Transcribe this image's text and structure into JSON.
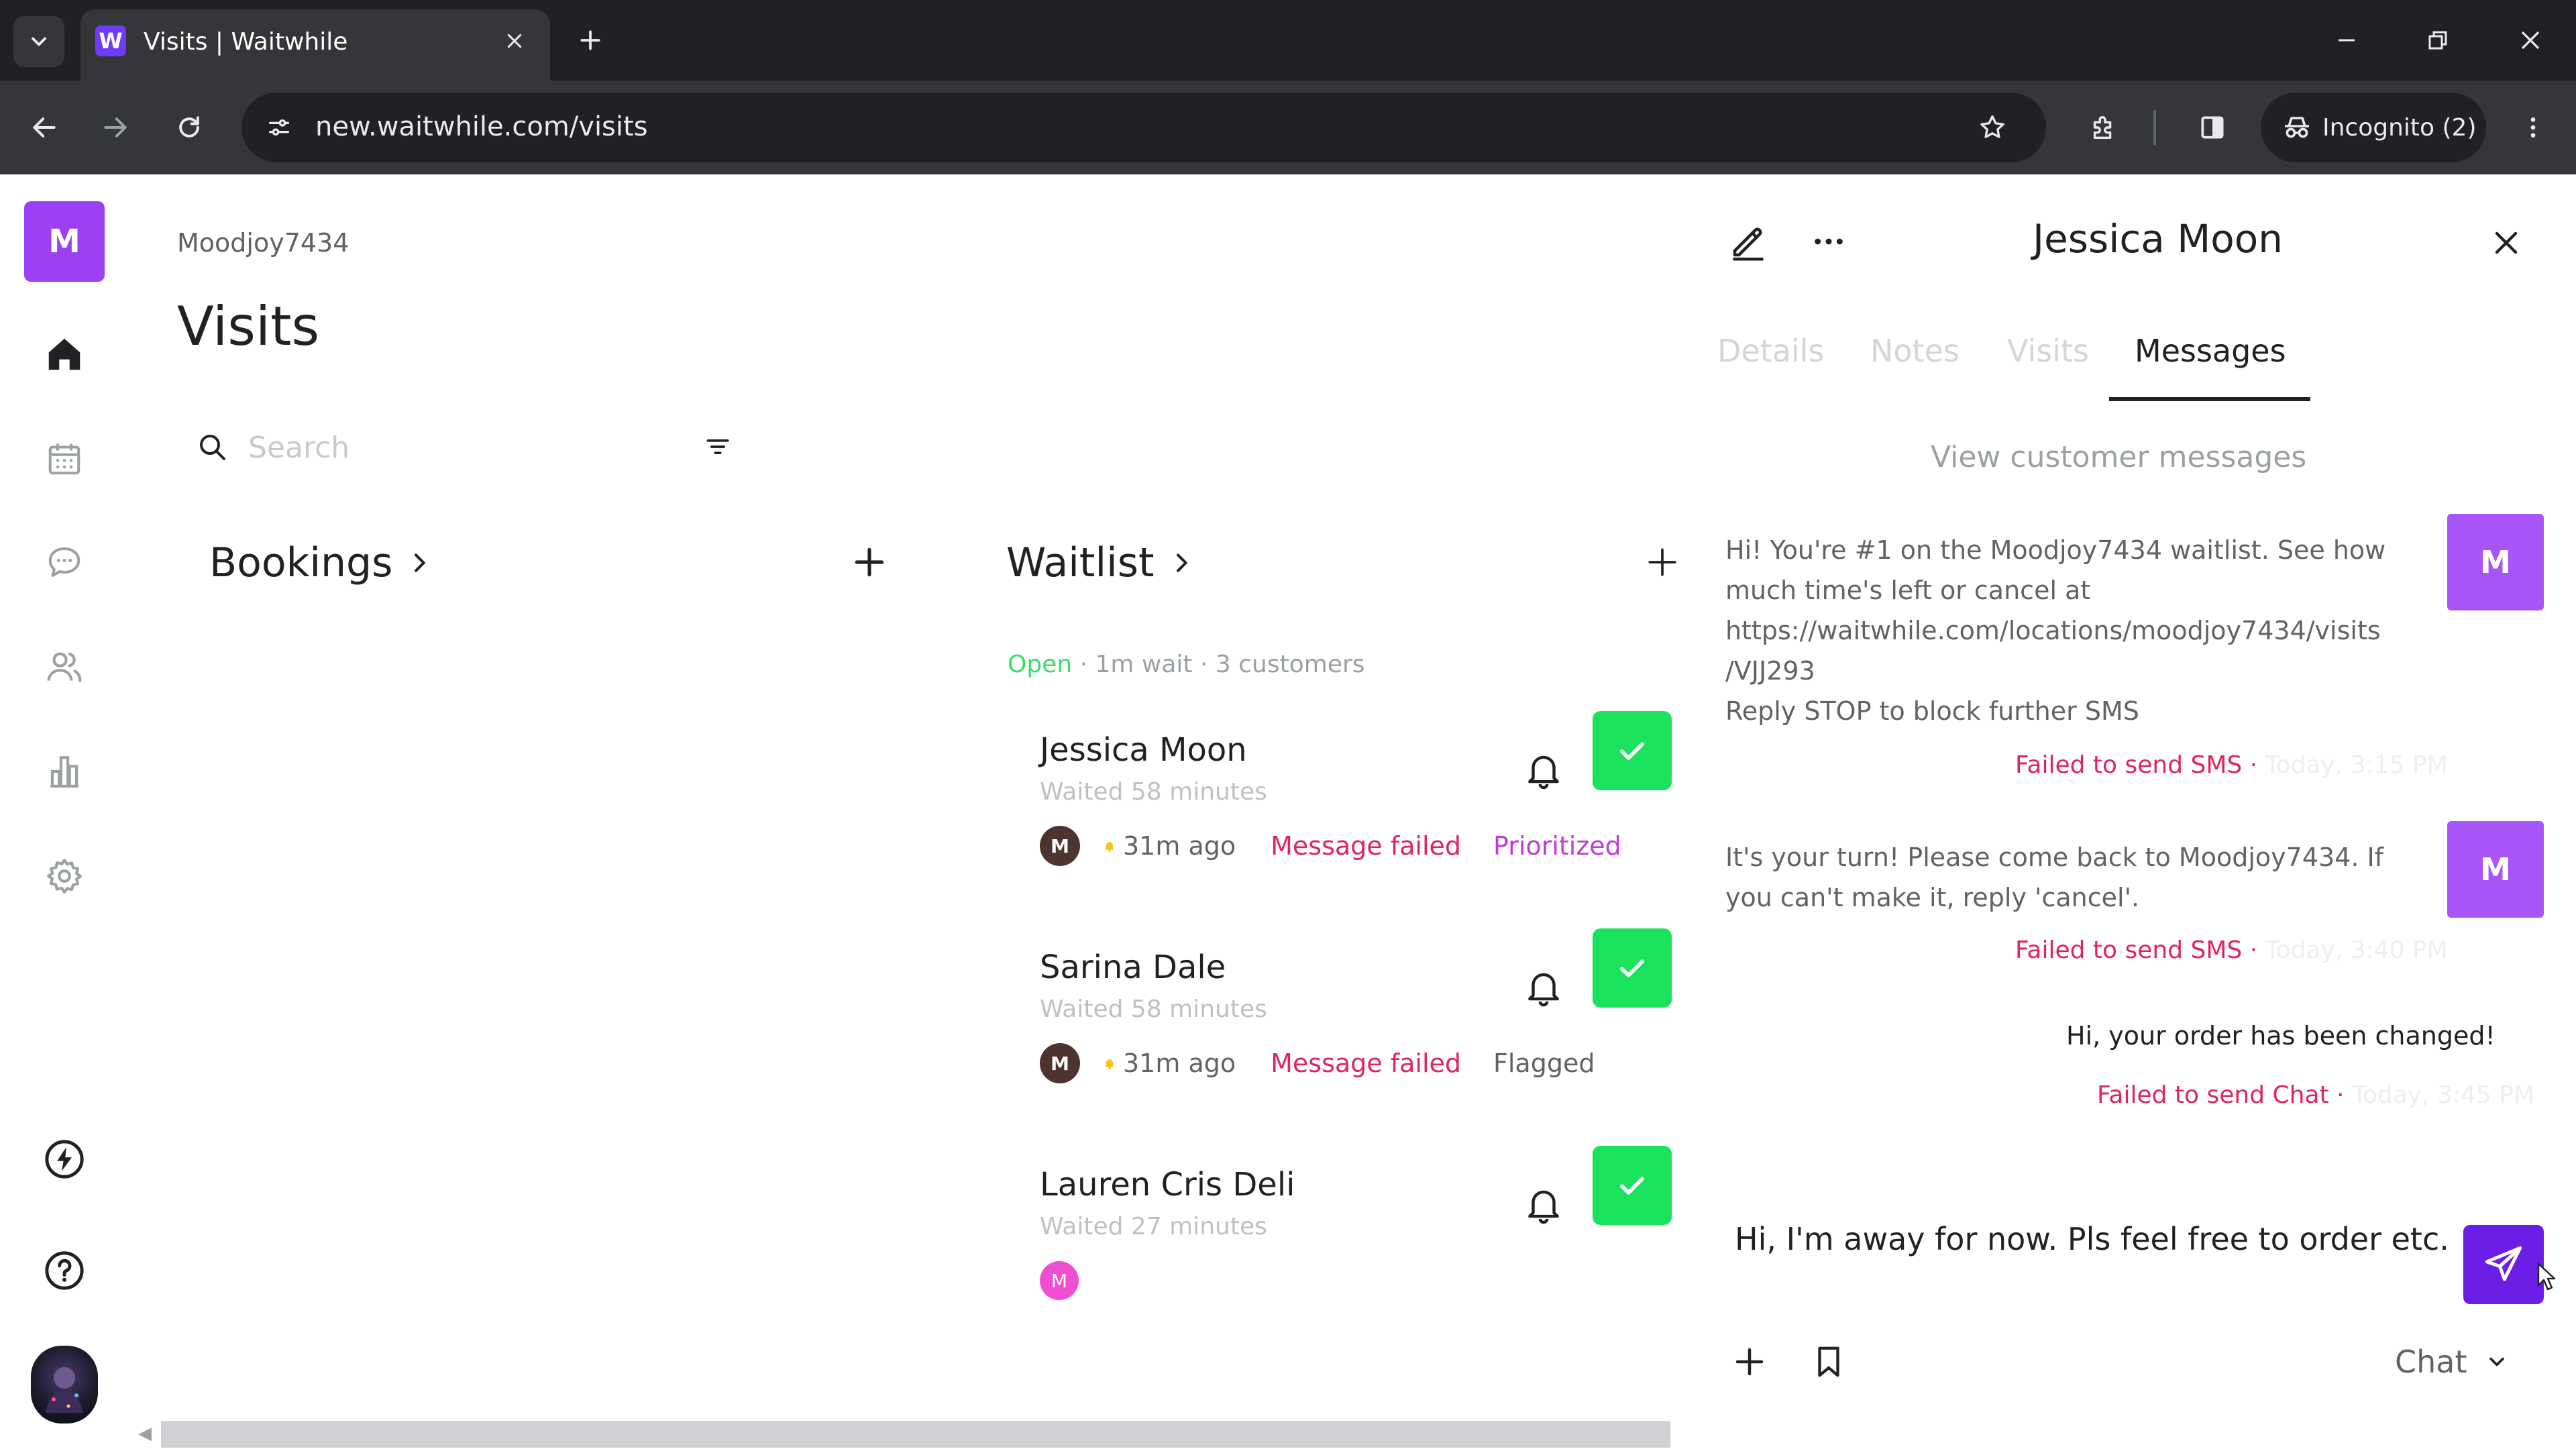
{
  "browser": {
    "tab_title": "Visits | Waitwhile",
    "favicon_letter": "W",
    "url": "new.waitwhile.com/visits",
    "incognito_label": "Incognito (2)"
  },
  "sidebar": {
    "org_initial": "M",
    "nav_icons": [
      "home-icon",
      "calendar-icon",
      "chat-icon",
      "customers-icon",
      "analytics-icon",
      "settings-icon",
      "lightning-icon",
      "help-icon"
    ]
  },
  "main": {
    "org_name": "Moodjoy7434",
    "title": "Visits",
    "search_placeholder": "Search",
    "bookings_label": "Bookings",
    "waitlist_label": "Waitlist",
    "waitlist_status": {
      "open": "Open",
      "wait": "1m wait",
      "customers": "3 customers",
      "separator": " · "
    },
    "waitlist": [
      {
        "name": "Jessica Moon",
        "waited": "Waited 58 minutes",
        "avatar": "M",
        "ago": "31m ago",
        "status": "Message failed",
        "tag": "Prioritized"
      },
      {
        "name": "Sarina Dale",
        "waited": "Waited 58 minutes",
        "avatar": "M",
        "ago": "31m ago",
        "status": "Message failed",
        "tag": "Flagged"
      },
      {
        "name": "Lauren Cris Deli",
        "waited": "Waited 27 minutes",
        "avatar": "M"
      }
    ]
  },
  "panel": {
    "customer_name": "Jessica Moon",
    "tabs": [
      "Details",
      "Notes",
      "Visits",
      "Messages"
    ],
    "active_tab": "Messages",
    "view_messages": "View customer messages",
    "messages": [
      {
        "lines": [
          "Hi! You're #1 on the Moodjoy7434 waitlist. See how",
          "much time's left or cancel at",
          "https://waitwhile.com/locations/moodjoy7434/visits",
          "/VJJ293",
          "Reply STOP to block further SMS"
        ],
        "status": "Failed to send SMS",
        "time": "Today, 3:15 PM",
        "sender": "M"
      },
      {
        "lines": [
          "It's your turn! Please come back to Moodjoy7434. If",
          "you can't make it, reply 'cancel'."
        ],
        "status": "Failed to send SMS",
        "time": "Today, 3:40 PM",
        "sender": "M"
      },
      {
        "lines": [
          "Hi, your order has been changed!"
        ],
        "status": "Failed to send Chat",
        "time": "Today, 3:45 PM"
      }
    ],
    "composer_text": "Hi, I'm away for now. Pls feel free to order etc.",
    "channel": "Chat"
  }
}
